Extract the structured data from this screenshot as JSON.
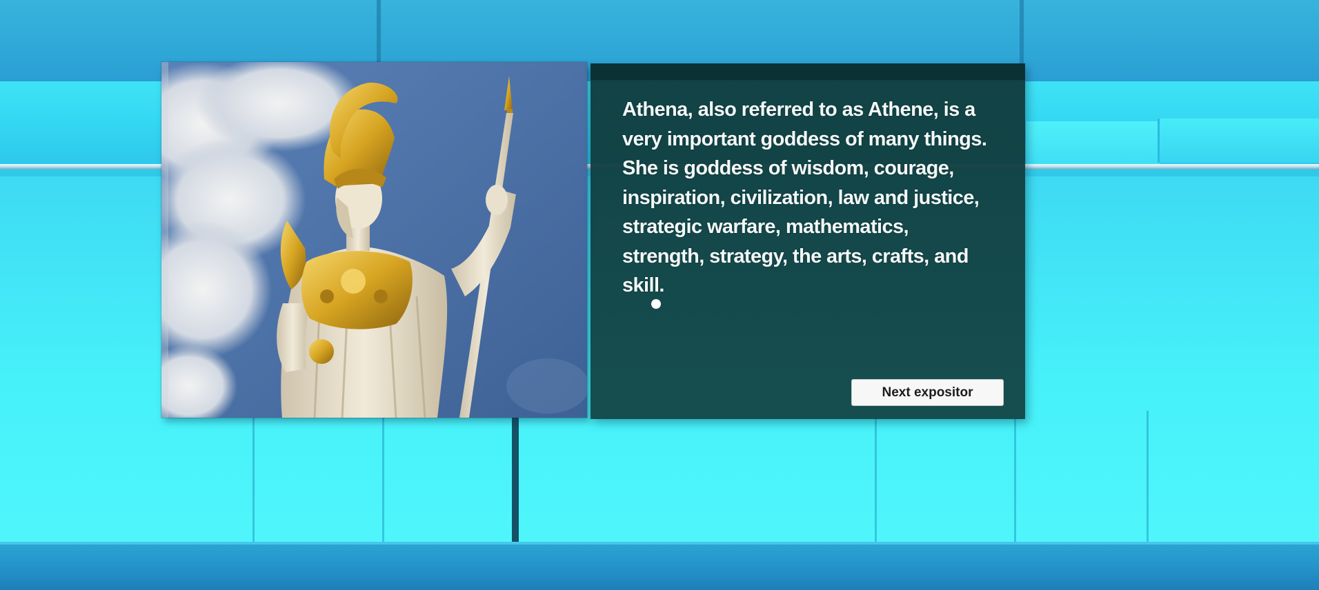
{
  "exhibit": {
    "image_subject": "statue-of-athena",
    "description": "Athena, also referred to as Athene, is a very important goddess of many things. She is goddess of wisdom, courage, inspiration, civilization, law and justice, strategic warfare, mathematics, strength, strategy, the arts, crafts, and skill.",
    "next_button_label": "Next expositor"
  },
  "colors": {
    "wall_light": "#3fe6f4",
    "wall_dark": "#2b9ed3",
    "panel_bg": "#103c3e",
    "text": "#f4f8f8",
    "button_bg": "#f7f7f7"
  }
}
